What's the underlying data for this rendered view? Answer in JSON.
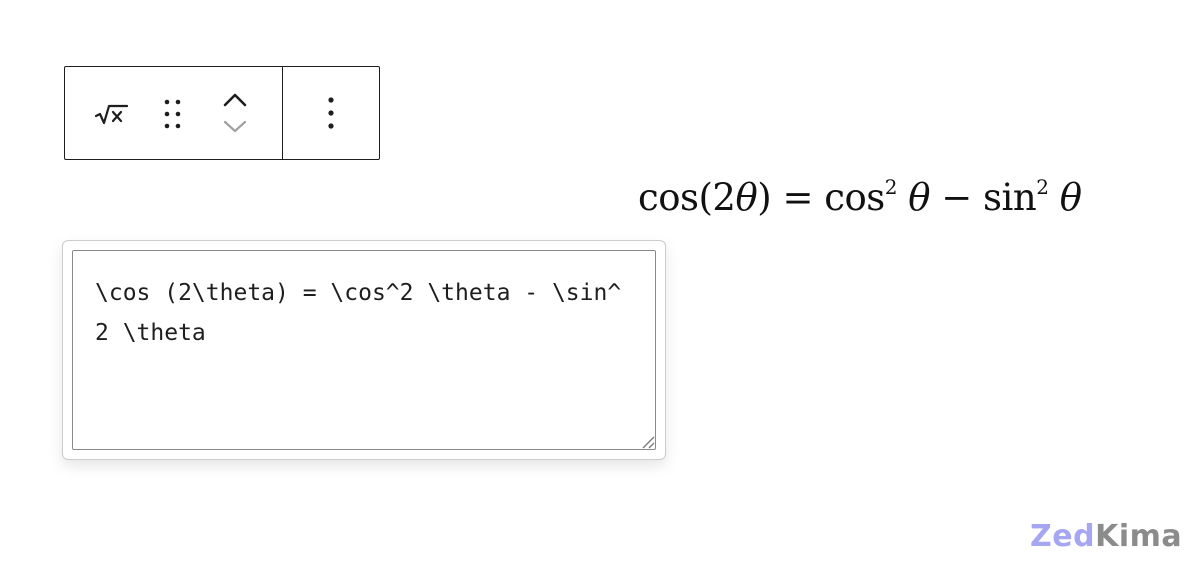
{
  "toolbar": {
    "buttons": [
      {
        "name": "math-block-button",
        "icon": "square-root-icon"
      },
      {
        "name": "drag-handle",
        "icon": "drag-dots-icon"
      },
      {
        "name": "move-up-button",
        "icon": "chevron-up-icon"
      },
      {
        "name": "move-down-button",
        "icon": "chevron-down-icon",
        "disabled": true
      },
      {
        "name": "more-options-button",
        "icon": "vertical-ellipsis-icon"
      }
    ]
  },
  "formula": {
    "cos": "cos",
    "open": "(2",
    "theta": "θ",
    "close": ")",
    "equals": " = ",
    "cos2": "cos",
    "exp1": "2",
    "minus": " − ",
    "sin2": "sin",
    "exp2": "2"
  },
  "editor": {
    "value": "\\cos (2\\theta) = \\cos^2 \\theta - \\sin^2 \\theta"
  },
  "watermark": {
    "part1": "Zed",
    "part2": "Kima"
  },
  "colors": {
    "border": "#1e1e1e",
    "disabled": "#a0a0a0",
    "logo_accent": "#a6a6f2",
    "logo_gray": "#8b8b8b"
  }
}
